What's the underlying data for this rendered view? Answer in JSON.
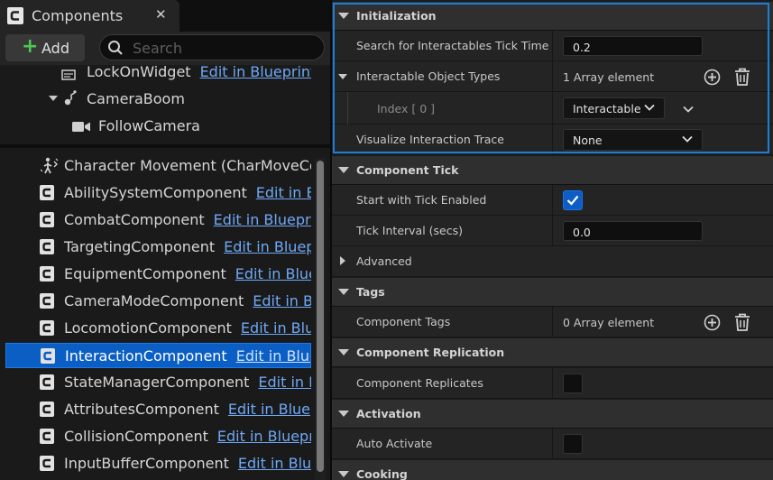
{
  "components_panel": {
    "tab_title": "Components",
    "add_label": "Add",
    "search_placeholder": "Search",
    "tree_items": [
      {
        "name": "LockOnWidget",
        "edit": "Edit in Blueprint",
        "icon": "widget-icon"
      },
      {
        "name": "CameraBoom",
        "edit": "",
        "icon": "spring-arm-icon"
      },
      {
        "name": "FollowCamera",
        "edit": "",
        "icon": "camera-icon"
      }
    ],
    "list_items": [
      {
        "name": "Character Movement (CharMoveComp)",
        "edit": "",
        "icon": "character-movement-icon"
      },
      {
        "name": "AbilitySystemComponent",
        "edit": "Edit in Blueprint",
        "icon": "component-icon"
      },
      {
        "name": "CombatComponent",
        "edit": "Edit in Blueprint",
        "icon": "component-icon"
      },
      {
        "name": "TargetingComponent",
        "edit": "Edit in Blueprint",
        "icon": "component-icon"
      },
      {
        "name": "EquipmentComponent",
        "edit": "Edit in Blueprint",
        "icon": "component-icon"
      },
      {
        "name": "CameraModeComponent",
        "edit": "Edit in Blueprint",
        "icon": "component-icon"
      },
      {
        "name": "LocomotionComponent",
        "edit": "Edit in Blueprint",
        "icon": "component-icon"
      },
      {
        "name": "InteractionComponent",
        "edit": "Edit in Blueprint",
        "icon": "component-icon",
        "selected": true
      },
      {
        "name": "StateManagerComponent",
        "edit": "Edit in Blueprint",
        "icon": "component-icon"
      },
      {
        "name": "AttributesComponent",
        "edit": "Edit in Blueprint",
        "icon": "component-icon"
      },
      {
        "name": "CollisionComponent",
        "edit": "Edit in Blueprint",
        "icon": "component-icon"
      },
      {
        "name": "InputBufferComponent",
        "edit": "Edit in Blueprint",
        "icon": "component-icon"
      }
    ]
  },
  "details": {
    "sections": {
      "initialization": "Initialization",
      "component_tick": "Component Tick",
      "advanced": "Advanced",
      "tags": "Tags",
      "component_replication": "Component Replication",
      "activation": "Activation",
      "cooking": "Cooking"
    },
    "props": {
      "search_tick_label": "Search for Interactables Tick Time",
      "search_tick_value": "0.2",
      "object_types_label": "Interactable Object Types",
      "object_types_value": "1 Array element",
      "index_label": "Index [ 0 ]",
      "index_value": "Interactable",
      "visualize_label": "Visualize Interaction Trace",
      "visualize_value": "None",
      "start_tick_label": "Start with Tick Enabled",
      "start_tick_checked": true,
      "tick_interval_label": "Tick Interval (secs)",
      "tick_interval_value": "0.0",
      "component_tags_label": "Component Tags",
      "component_tags_value": "0 Array element",
      "replicates_label": "Component Replicates",
      "replicates_checked": false,
      "auto_activate_label": "Auto Activate",
      "auto_activate_checked": false
    }
  },
  "colors": {
    "accent": "#0b5fc4",
    "highlight_border": "#1b7fd8",
    "link": "#6ea8f5",
    "add_plus": "#4fc94f"
  }
}
